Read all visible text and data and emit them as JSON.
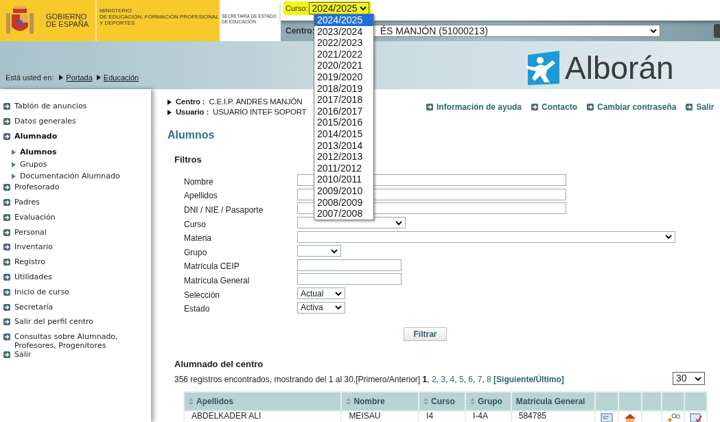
{
  "header": {
    "gov_name": [
      "GOBIERNO",
      "DE ESPAÑA"
    ],
    "ministry": [
      "MINISTERIO",
      "DE EDUCACIÓN, FORMACIÓN PROFESIONAL",
      "Y DEPORTES"
    ],
    "secretariat": [
      "SECRETARÍA DE ESTADO",
      "DE EDUCACIÓN"
    ]
  },
  "course_select": {
    "label": "Curso:",
    "value": "2024/2025",
    "expanded": true,
    "options": [
      {
        "label": "2024/2025",
        "selected": true
      },
      {
        "label": "2023/2024",
        "selected": false
      },
      {
        "label": "2022/2023",
        "selected": false
      },
      {
        "label": "2021/2022",
        "selected": false
      },
      {
        "label": "2020/2021",
        "selected": false
      },
      {
        "label": "2019/2020",
        "selected": false
      },
      {
        "label": "2018/2019",
        "selected": false
      },
      {
        "label": "2017/2018",
        "selected": false
      },
      {
        "label": "2016/2017",
        "selected": false
      },
      {
        "label": "2015/2016",
        "selected": false
      },
      {
        "label": "2014/2015",
        "selected": false
      },
      {
        "label": "2013/2014",
        "selected": false
      },
      {
        "label": "2012/2013",
        "selected": false
      },
      {
        "label": "2011/2012",
        "selected": false
      },
      {
        "label": "2010/2011",
        "selected": false
      },
      {
        "label": "2009/2010",
        "selected": false
      },
      {
        "label": "2008/2009",
        "selected": false
      },
      {
        "label": "2007/2008",
        "selected": false
      }
    ]
  },
  "centro_select": {
    "label": "Centro:",
    "value": "ÉS MANJÓN (51000213)"
  },
  "app_logo": {
    "text": "Alborán"
  },
  "breadcrumb": {
    "label": "Está usted en:",
    "items": [
      "Portada",
      "Educación"
    ]
  },
  "sidebar": {
    "items": [
      {
        "label": "Tablón de anuncios",
        "expanded": false
      },
      {
        "label": "Datos generales",
        "expanded": false
      },
      {
        "label": "Alumnado",
        "expanded": true,
        "children": [
          {
            "label": "Alumnos",
            "selected": true
          },
          {
            "label": "Grupos",
            "selected": false
          },
          {
            "label": "Documentación Alumnado",
            "selected": false
          }
        ]
      },
      {
        "label": "Profesorado",
        "expanded": false
      },
      {
        "label": "Padres",
        "expanded": false
      },
      {
        "label": "Evaluación",
        "expanded": false
      },
      {
        "label": "Personal",
        "expanded": false
      },
      {
        "label": "Inventario",
        "expanded": false
      },
      {
        "label": "Registro",
        "expanded": false
      },
      {
        "label": "Utilidades",
        "expanded": false
      },
      {
        "label": "Inicio de curso",
        "expanded": false
      },
      {
        "label": "Secretaría",
        "expanded": false
      },
      {
        "label": "Salir del perfil centro",
        "expanded": false
      },
      {
        "label": "Consultas sobre Alumnado, Profesores, Progenitores",
        "expanded": false
      },
      {
        "label": "Salir",
        "expanded": false
      }
    ]
  },
  "session_info": [
    {
      "label": "Centro :",
      "value": "C.E.I.P. ANDRÉS MANJÓN"
    },
    {
      "label": "Usuario :",
      "value": "USUARIO INTEF SOPORT"
    }
  ],
  "top_links": [
    "Información de ayuda",
    "Contacto",
    "Cambiar contraseña",
    "Salir"
  ],
  "page_title": "Alumnos",
  "filters": {
    "title": "Filtros",
    "button": "Filtrar",
    "fields": [
      {
        "label": "Nombre",
        "kind": "text"
      },
      {
        "label": "Apellidos",
        "kind": "text"
      },
      {
        "label": "DNI / NIE / Pasaporte",
        "kind": "text"
      },
      {
        "label": "Curso",
        "kind": "select"
      },
      {
        "label": "Materia",
        "kind": "select"
      },
      {
        "label": "Grupo",
        "kind": "select"
      },
      {
        "label": "Matrícula CEIP",
        "kind": "text"
      },
      {
        "label": "Matrícula General",
        "kind": "text"
      },
      {
        "label": "Selección",
        "kind": "select",
        "value": "Actual"
      },
      {
        "label": "Estado",
        "kind": "select",
        "value": "Activa"
      }
    ]
  },
  "results": {
    "title": "Alumnado del centro",
    "summary": "356 registros encontrados, mostrando del 1 al 30.[Primero/Anterior]",
    "separator": ",",
    "pages": [
      {
        "label": "1",
        "selected": true
      },
      {
        "label": "2",
        "selected": false
      },
      {
        "label": "3",
        "selected": false
      },
      {
        "label": "4",
        "selected": false
      },
      {
        "label": "5",
        "selected": false
      },
      {
        "label": "6",
        "selected": false
      },
      {
        "label": "7",
        "selected": false
      },
      {
        "label": "8",
        "selected": false
      }
    ],
    "next": "[Siguiente/Último]",
    "per_page": "30",
    "columns": [
      {
        "label": "Apellidos",
        "sortable": true
      },
      {
        "label": "Nombre",
        "sortable": true
      },
      {
        "label": "Curso",
        "sortable": true
      },
      {
        "label": "Grupo",
        "sortable": true
      },
      {
        "label": "Matrícula General",
        "sortable": false
      }
    ],
    "rows": [
      {
        "cells": [
          "ABDELKADER ALI",
          "MEISAU",
          "I4",
          "I-4A",
          "584785"
        ]
      }
    ]
  }
}
